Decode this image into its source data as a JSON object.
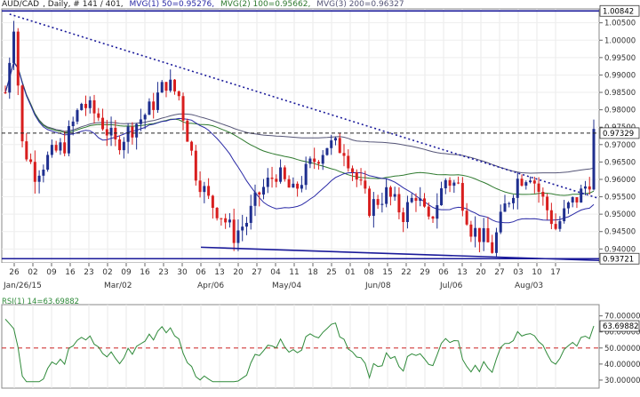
{
  "header": {
    "symbol": "AUD/CAD",
    "info": ", Daily, # 141 / 401,",
    "mvg1": "MVG(1) 50=0.95276,",
    "mvg2": "MVG(2) 100=0.95662,",
    "mvg3": "MVG(3) 200=0.96327"
  },
  "rsi_header": "RSI(1) 14=63.69882",
  "colors": {
    "up": "#1f2f8f",
    "down": "#d81e1e",
    "mvg50": "#2a2aa6",
    "mvg100": "#2f7a2f",
    "mvg200": "#555577",
    "trendline": "#1a1a9a",
    "rsi_line": "#2f8a3a",
    "rsi_level": "#d03a3a"
  },
  "chart_data": [
    {
      "type": "candlestick",
      "name": "AUD/CAD Daily",
      "ylim": [
        0.936,
        1.009
      ],
      "y_ticks": [
        "1.00500",
        "1.00000",
        "0.99500",
        "0.99000",
        "0.98500",
        "0.98000",
        "0.97500",
        "0.97000",
        "0.96500",
        "0.96000",
        "0.95500",
        "0.95000",
        "0.94500",
        "0.94000"
      ],
      "x_tick_labels": [
        "26",
        "02",
        "09",
        "16",
        "23",
        "02",
        "09",
        "16",
        "23",
        "30",
        "06",
        "13",
        "20",
        "27",
        "04",
        "11",
        "18",
        "25",
        "01",
        "08",
        "15",
        "22",
        "29",
        "06",
        "13",
        "20",
        "27",
        "03",
        "10",
        "17"
      ],
      "month_labels": [
        "Jan/26/15",
        "Mar/02",
        "Apr/06",
        "May/04",
        "Jun/08",
        "Jul/06",
        "Aug/03"
      ],
      "level_labels": {
        "top": "1.00842",
        "current": "0.97329",
        "bottom": "0.93721"
      },
      "levels": {
        "top": 1.00842,
        "current": 0.97329,
        "bottom": 0.93721
      },
      "last_close": 0.97329,
      "ma_last": {
        "mvg50": 0.95276,
        "mvg100": 0.95662,
        "mvg200": 0.96327
      },
      "trendline": {
        "from": [
          "Jan/26/15",
          1.0075
        ],
        "to": [
          "Aug/17",
          0.9545
        ]
      },
      "support_line": {
        "from": [
          "Apr/06",
          0.9405
        ],
        "to": [
          "Aug/17",
          0.9367
        ]
      },
      "bars": 140
    },
    {
      "type": "line",
      "name": "RSI(1) 14",
      "ylim": [
        25,
        77
      ],
      "y_ticks": [
        "70.00000",
        "60.00000",
        "50.00000",
        "40.00000",
        "30.00000"
      ],
      "last_label": "63.69882",
      "last_value": 63.69882,
      "level": 50
    }
  ]
}
